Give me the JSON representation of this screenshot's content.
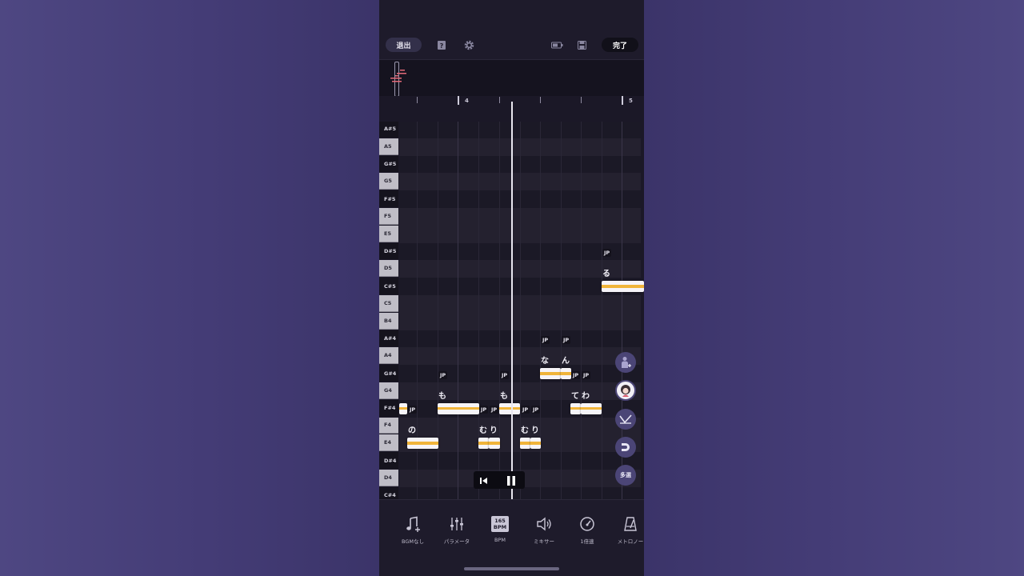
{
  "toolbar": {
    "exit_label": "退出",
    "help_icon": "help-book-icon",
    "settings_icon": "gear-icon",
    "battery_icon": "battery-icon",
    "save_icon": "save-icon",
    "done_label": "完了"
  },
  "ruler": {
    "bars": [
      "4",
      "5"
    ]
  },
  "piano_keys": [
    {
      "label": "A#5",
      "color": "black"
    },
    {
      "label": "A5",
      "color": "white"
    },
    {
      "label": "G#5",
      "color": "black"
    },
    {
      "label": "G5",
      "color": "white"
    },
    {
      "label": "F#5",
      "color": "black"
    },
    {
      "label": "F5",
      "color": "white"
    },
    {
      "label": "E5",
      "color": "white"
    },
    {
      "label": "D#5",
      "color": "black"
    },
    {
      "label": "D5",
      "color": "white"
    },
    {
      "label": "C#5",
      "color": "black"
    },
    {
      "label": "C5",
      "color": "white"
    },
    {
      "label": "B4",
      "color": "white"
    },
    {
      "label": "A#4",
      "color": "black"
    },
    {
      "label": "A4",
      "color": "white"
    },
    {
      "label": "G#4",
      "color": "black"
    },
    {
      "label": "G4",
      "color": "white"
    },
    {
      "label": "F#4",
      "color": "black"
    },
    {
      "label": "F4",
      "color": "white"
    },
    {
      "label": "E4",
      "color": "white"
    },
    {
      "label": "D#4",
      "color": "black"
    },
    {
      "label": "D4",
      "color": "white"
    },
    {
      "label": "C#4",
      "color": "black"
    }
  ],
  "notes": [
    {
      "lyric": "の",
      "pitch": "E4",
      "lang": "JP"
    },
    {
      "lyric": "も",
      "pitch": "F#4",
      "lang": "JP"
    },
    {
      "lyric": "む",
      "pitch": "E4",
      "lang": "JP"
    },
    {
      "lyric": "り",
      "pitch": "E4",
      "lang": "JP"
    },
    {
      "lyric": "も",
      "pitch": "F#4",
      "lang": "JP"
    },
    {
      "lyric": "む",
      "pitch": "E4",
      "lang": "JP"
    },
    {
      "lyric": "り",
      "pitch": "E4",
      "lang": "JP"
    },
    {
      "lyric": "な",
      "pitch": "G#4",
      "lang": "JP"
    },
    {
      "lyric": "ん",
      "pitch": "G#4",
      "lang": "JP"
    },
    {
      "lyric": "て",
      "pitch": "F#4",
      "lang": "JP"
    },
    {
      "lyric": "わ",
      "pitch": "F#4",
      "lang": "JP"
    },
    {
      "lyric": "る",
      "pitch": "C#5",
      "lang": "JP"
    }
  ],
  "note_lang_label": "JP",
  "transport": {
    "rewind_icon": "skip-back-icon",
    "pause_icon": "pause-icon"
  },
  "side_tools": {
    "singer_add_icon": "singer-add-icon",
    "avatar_icon": "singer-avatar-icon",
    "pitch_curve_icon": "pitch-curve-icon",
    "magnet_icon": "magnet-icon",
    "multi_select_label": "多選"
  },
  "bottom_tools": [
    {
      "label": "BGMなし",
      "icon": "music-note-add-icon"
    },
    {
      "label": "パラメータ",
      "icon": "sliders-icon"
    },
    {
      "label": "BPM",
      "icon": "bpm-badge-icon",
      "badge": "165\nBPM"
    },
    {
      "label": "ミキサー",
      "icon": "speaker-icon"
    },
    {
      "label": "1倍速",
      "icon": "speedometer-icon"
    },
    {
      "label": "メトロノー",
      "icon": "metronome-icon"
    }
  ],
  "bpm_value": "165",
  "bpm_unit": "BPM"
}
